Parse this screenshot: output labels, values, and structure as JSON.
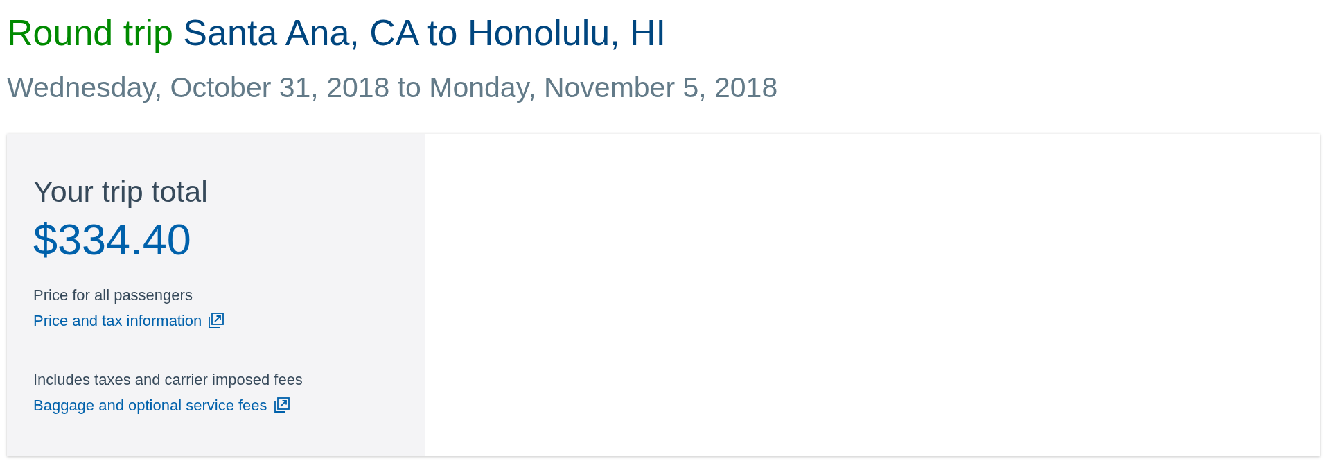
{
  "header": {
    "trip_type": "Round trip",
    "route": "Santa Ana, CA to Honolulu, HI",
    "dates": "Wednesday, October 31, 2018 to Monday, November 5, 2018"
  },
  "summary": {
    "heading": "Your trip total",
    "total": "$334.40",
    "price_note": "Price for all passengers",
    "price_link": "Price and tax information",
    "fees_note": "Includes taxes and carrier imposed fees",
    "fees_link": "Baggage and optional service fees"
  }
}
